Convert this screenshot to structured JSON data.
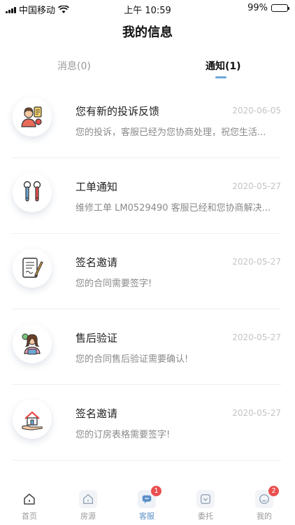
{
  "status_bar": {
    "carrier": "中国移动",
    "time": "上午 10:59",
    "battery": "99%"
  },
  "header": {
    "title": "我的信息"
  },
  "tabs": [
    {
      "label": "消息(0)"
    },
    {
      "label": "通知(1)"
    }
  ],
  "notifications": [
    {
      "icon": "complaint-agent-icon",
      "title": "您有新的投诉反馈",
      "date": "2020-06-05",
      "desc": "您的投诉，客服已经为您协商处理，祝您生活..."
    },
    {
      "icon": "repair-tools-icon",
      "title": "工单通知",
      "date": "2020-05-27",
      "desc": "维修工单 LM0529490 客服已经和您协商解决..."
    },
    {
      "icon": "contract-sign-icon",
      "title": "签名邀请",
      "date": "2020-05-27",
      "desc": "您的合同需要签字!"
    },
    {
      "icon": "support-agent-icon",
      "title": "售后验证",
      "date": "2020-05-27",
      "desc": "您的合同售后验证需要确认!"
    },
    {
      "icon": "house-in-hand-icon",
      "title": "签名邀请",
      "date": "2020-05-27",
      "desc": "您的订房表格需要签字!"
    }
  ],
  "bottom_nav": [
    {
      "label": "首页",
      "icon": "home-icon"
    },
    {
      "label": "房源",
      "icon": "listing-icon"
    },
    {
      "label": "客服",
      "icon": "chat-icon",
      "badge": "1"
    },
    {
      "label": "委托",
      "icon": "commission-icon"
    },
    {
      "label": "我的",
      "icon": "profile-icon",
      "badge": "2"
    }
  ],
  "colors": {
    "accent": "#5c8fc8",
    "tab_indicator": "#6fa7d6",
    "badge": "#e94f4f"
  }
}
